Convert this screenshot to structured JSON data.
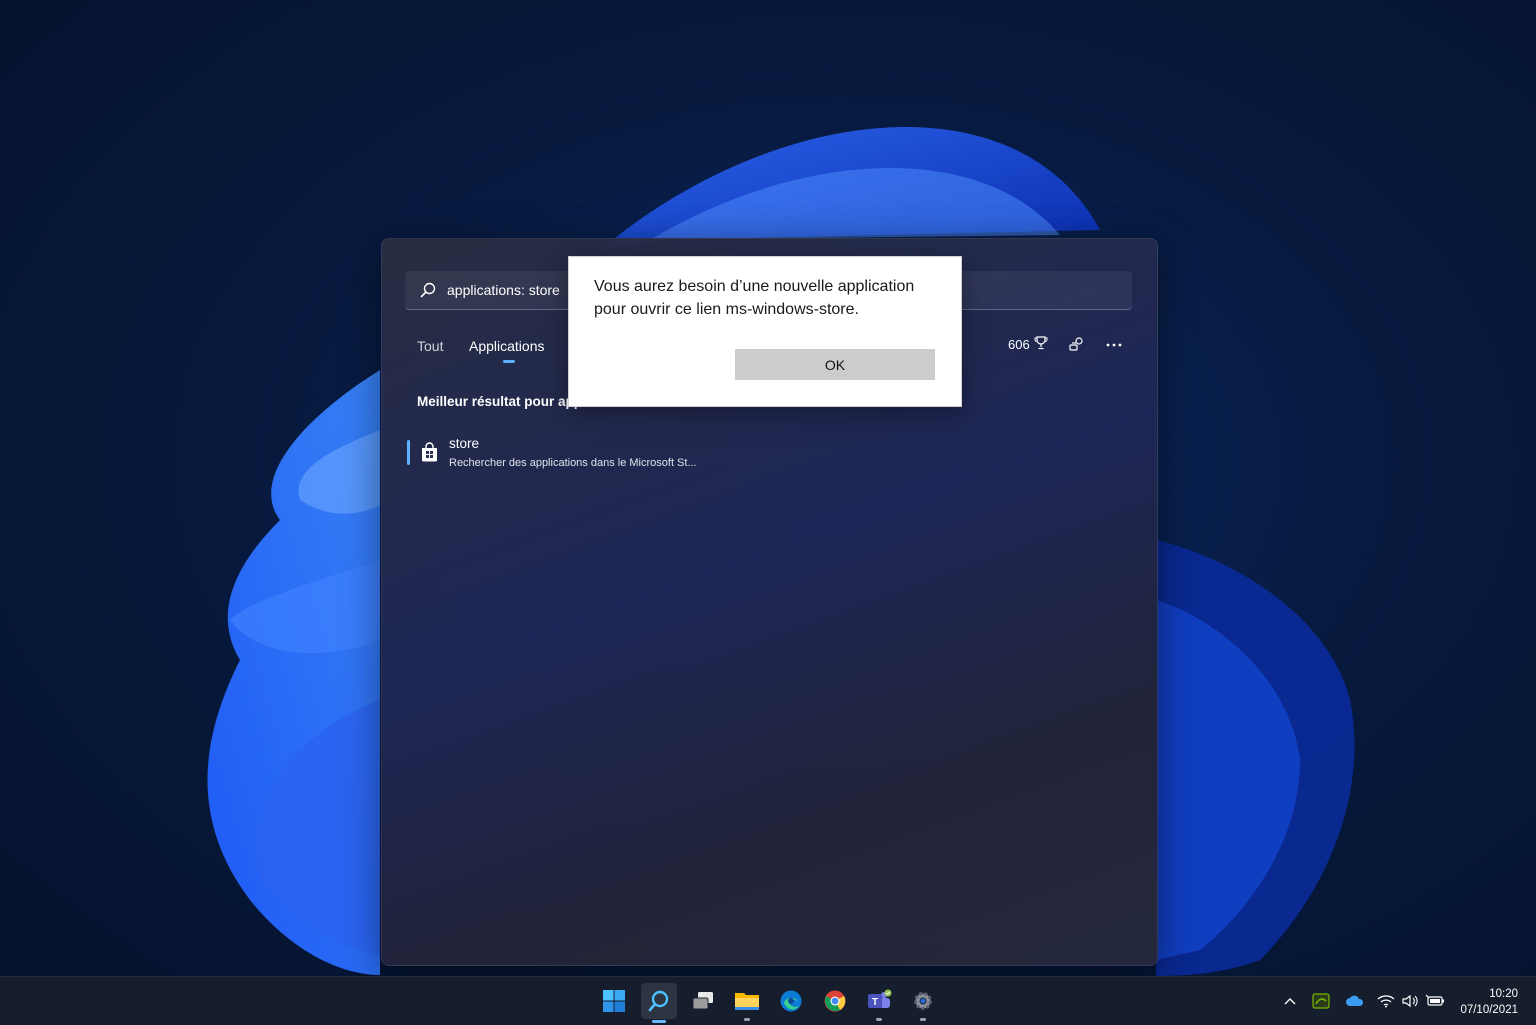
{
  "search": {
    "query": "applications: store"
  },
  "tabs": [
    {
      "label": "Tout"
    },
    {
      "label": "Applications"
    }
  ],
  "header": {
    "points": "606"
  },
  "results": {
    "section_title": "Meilleur résultat pour applications",
    "best": {
      "name": "store",
      "description": "Rechercher des applications dans le Microsoft St..."
    }
  },
  "dialog": {
    "message": "Vous aurez besoin d’une nouvelle application pour ouvrir ce lien ms-windows-store.",
    "ok_label": "OK"
  },
  "taskbar": {
    "time": "10:20",
    "date": "07/10/2021"
  },
  "colors": {
    "accent": "#5fb2ff",
    "dialog_button": "#cccccc"
  }
}
